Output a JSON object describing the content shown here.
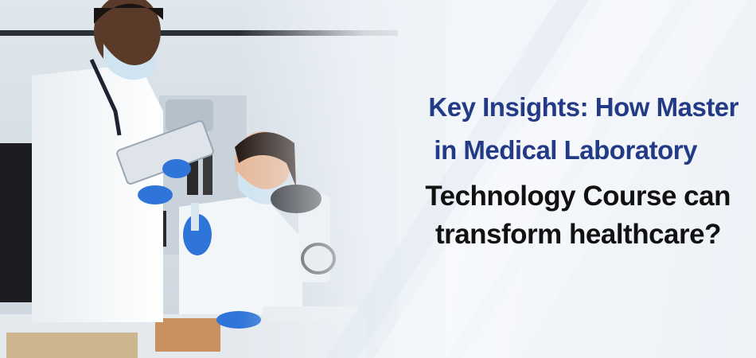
{
  "banner": {
    "headline": {
      "line1": "Key Insights: How Master",
      "line2": "in Medical Laboratory",
      "line3": "Technology Course can",
      "line4": "transform healthcare?"
    },
    "colors": {
      "accent_blue": "#233a86",
      "text_dark": "#111111",
      "background": "#eef3f8",
      "gloves": "#2f74d8"
    }
  }
}
